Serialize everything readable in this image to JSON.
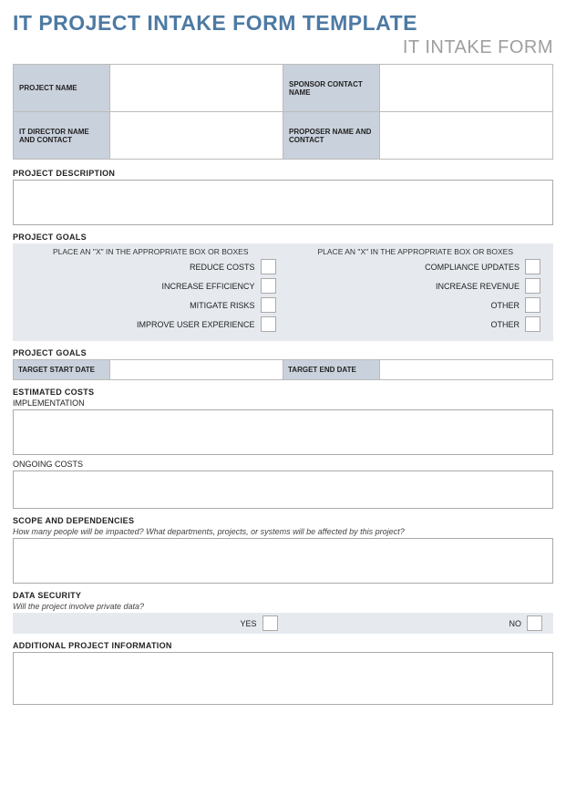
{
  "title": "IT PROJECT INTAKE FORM TEMPLATE",
  "subtitle": "IT INTAKE FORM",
  "headerFields": {
    "projectName": {
      "label": "PROJECT NAME",
      "value": ""
    },
    "sponsor": {
      "label": "SPONSOR CONTACT NAME",
      "value": ""
    },
    "director": {
      "label": "IT DIRECTOR NAME AND CONTACT",
      "value": ""
    },
    "proposer": {
      "label": "PROPOSER NAME AND CONTACT",
      "value": ""
    }
  },
  "description": {
    "heading": "PROJECT DESCRIPTION",
    "value": ""
  },
  "goals": {
    "heading": "PROJECT GOALS",
    "hintLeft": "PLACE AN \"X\" IN THE APPROPRIATE BOX OR BOXES",
    "hintRight": "PLACE AN \"X\" IN THE APPROPRIATE BOX OR BOXES",
    "rows": [
      {
        "left": "REDUCE COSTS",
        "right": "COMPLIANCE UPDATES"
      },
      {
        "left": "INCREASE EFFICIENCY",
        "right": "INCREASE REVENUE"
      },
      {
        "left": "MITIGATE RISKS",
        "right": "OTHER"
      },
      {
        "left": "IMPROVE USER EXPERIENCE",
        "right": "OTHER"
      }
    ]
  },
  "dates": {
    "heading": "PROJECT GOALS",
    "start": {
      "label": "TARGET START DATE",
      "value": ""
    },
    "end": {
      "label": "TARGET END DATE",
      "value": ""
    }
  },
  "costs": {
    "heading": "ESTIMATED COSTS",
    "implLabel": "IMPLEMENTATION",
    "implValue": "",
    "ongoingLabel": "ONGOING COSTS",
    "ongoingValue": ""
  },
  "scope": {
    "heading": "SCOPE AND DEPENDENCIES",
    "hint": "How many people will be impacted? What departments, projects, or systems will be affected by this project?",
    "value": ""
  },
  "security": {
    "heading": "DATA SECURITY",
    "hint": "Will the project involve private data?",
    "yes": "YES",
    "no": "NO"
  },
  "additional": {
    "heading": "ADDITIONAL PROJECT INFORMATION",
    "value": ""
  }
}
